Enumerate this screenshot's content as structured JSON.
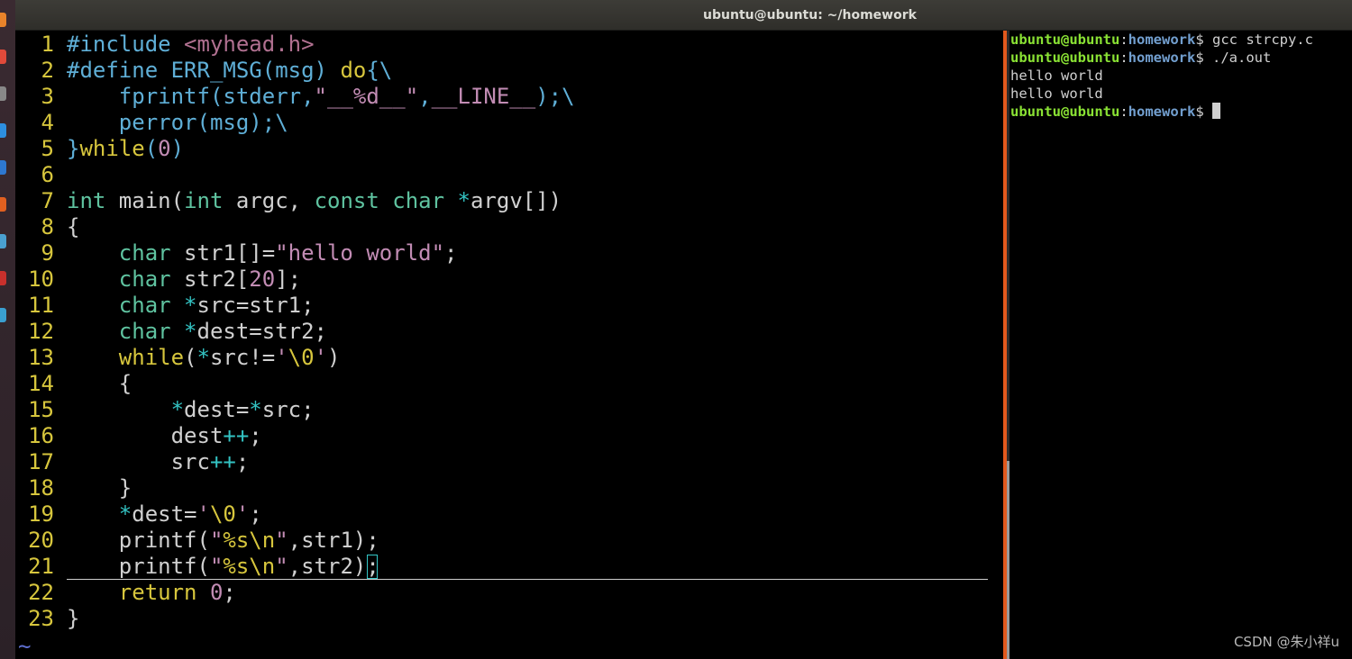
{
  "window": {
    "title": "ubuntu@ubuntu: ~/homework"
  },
  "launcher": {
    "icons": [
      "app-icon-1",
      "app-icon-2",
      "app-icon-3",
      "app-icon-4",
      "app-icon-5",
      "app-icon-6",
      "app-icon-7",
      "terminal-icon",
      "settings-icon"
    ],
    "colors": [
      "#e8832a",
      "#e04a3a",
      "#888888",
      "#2d8fe0",
      "#2e78d0",
      "#e06020",
      "#4aa0d0",
      "#c8302c",
      "#3a9fd0"
    ]
  },
  "vim": {
    "lines": [
      {
        "n": "1",
        "tokens": [
          [
            "pp",
            "#include "
          ],
          [
            "inc",
            "<myhead.h>"
          ]
        ]
      },
      {
        "n": "2",
        "tokens": [
          [
            "pp",
            "#define ERR_MSG(msg) "
          ],
          [
            "kw",
            "do"
          ],
          [
            "pp",
            "{\\"
          ]
        ]
      },
      {
        "n": "3",
        "tokens": [
          [
            "pp",
            "    fprintf(stderr,"
          ],
          [
            "str",
            "\"__%d__\""
          ],
          [
            "pp",
            ","
          ],
          [
            "str",
            "__LINE__"
          ],
          [
            "pp",
            ");\\"
          ]
        ]
      },
      {
        "n": "4",
        "tokens": [
          [
            "pp",
            "    perror(msg);\\"
          ]
        ]
      },
      {
        "n": "5",
        "tokens": [
          [
            "pp",
            "}"
          ],
          [
            "kw",
            "while"
          ],
          [
            "pp",
            "("
          ],
          [
            "num",
            "0"
          ],
          [
            "pp",
            ")"
          ]
        ]
      },
      {
        "n": "6",
        "tokens": []
      },
      {
        "n": "7",
        "tokens": [
          [
            "ty",
            "int"
          ],
          [
            "br",
            " main("
          ],
          [
            "ty",
            "int"
          ],
          [
            "br",
            " argc, "
          ],
          [
            "ty",
            "const char"
          ],
          [
            "br",
            " "
          ],
          [
            "op",
            "*"
          ],
          [
            "br",
            "argv[])"
          ]
        ]
      },
      {
        "n": "8",
        "tokens": [
          [
            "br",
            "{"
          ]
        ]
      },
      {
        "n": "9",
        "tokens": [
          [
            "br",
            "    "
          ],
          [
            "ty",
            "char"
          ],
          [
            "br",
            " str1[]="
          ],
          [
            "str",
            "\"hello world\""
          ],
          [
            "br",
            ";"
          ]
        ]
      },
      {
        "n": "10",
        "tokens": [
          [
            "br",
            "    "
          ],
          [
            "ty",
            "char"
          ],
          [
            "br",
            " str2["
          ],
          [
            "num",
            "20"
          ],
          [
            "br",
            "];"
          ]
        ]
      },
      {
        "n": "11",
        "tokens": [
          [
            "br",
            "    "
          ],
          [
            "ty",
            "char"
          ],
          [
            "br",
            " "
          ],
          [
            "op",
            "*"
          ],
          [
            "br",
            "src=str1;"
          ]
        ]
      },
      {
        "n": "12",
        "tokens": [
          [
            "br",
            "    "
          ],
          [
            "ty",
            "char"
          ],
          [
            "br",
            " "
          ],
          [
            "op",
            "*"
          ],
          [
            "br",
            "dest=str2;"
          ]
        ]
      },
      {
        "n": "13",
        "tokens": [
          [
            "br",
            "    "
          ],
          [
            "kw",
            "while"
          ],
          [
            "br",
            "("
          ],
          [
            "op",
            "*"
          ],
          [
            "br",
            "src!="
          ],
          [
            "str",
            "'"
          ],
          [
            "sp",
            "\\0"
          ],
          [
            "str",
            "'"
          ],
          [
            "br",
            ")"
          ]
        ]
      },
      {
        "n": "14",
        "tokens": [
          [
            "br",
            "    {"
          ]
        ]
      },
      {
        "n": "15",
        "tokens": [
          [
            "br",
            "        "
          ],
          [
            "op",
            "*"
          ],
          [
            "br",
            "dest="
          ],
          [
            "op",
            "*"
          ],
          [
            "br",
            "src;"
          ]
        ]
      },
      {
        "n": "16",
        "tokens": [
          [
            "br",
            "        dest"
          ],
          [
            "op",
            "++"
          ],
          [
            "br",
            ";"
          ]
        ]
      },
      {
        "n": "17",
        "tokens": [
          [
            "br",
            "        src"
          ],
          [
            "op",
            "++"
          ],
          [
            "br",
            ";"
          ]
        ]
      },
      {
        "n": "18",
        "tokens": [
          [
            "br",
            "    }"
          ]
        ]
      },
      {
        "n": "19",
        "tokens": [
          [
            "br",
            "    "
          ],
          [
            "op",
            "*"
          ],
          [
            "br",
            "dest="
          ],
          [
            "str",
            "'"
          ],
          [
            "sp",
            "\\0"
          ],
          [
            "str",
            "'"
          ],
          [
            "br",
            ";"
          ]
        ]
      },
      {
        "n": "20",
        "tokens": [
          [
            "br",
            "    printf("
          ],
          [
            "str",
            "\""
          ],
          [
            "sp",
            "%s\\n"
          ],
          [
            "str",
            "\""
          ],
          [
            "br",
            ",str1);"
          ]
        ]
      },
      {
        "n": "21",
        "tokens": [
          [
            "br",
            "    printf("
          ],
          [
            "str",
            "\""
          ],
          [
            "sp",
            "%s\\n"
          ],
          [
            "str",
            "\""
          ],
          [
            "br",
            ",str2);"
          ]
        ]
      },
      {
        "n": "22",
        "tokens": [
          [
            "br",
            "    "
          ],
          [
            "kw",
            "return"
          ],
          [
            "br",
            " "
          ],
          [
            "num",
            "0"
          ],
          [
            "br",
            ";"
          ]
        ]
      },
      {
        "n": "23",
        "tokens": [
          [
            "br",
            "}"
          ]
        ]
      }
    ],
    "tilde": "~",
    "cursor_line": "21"
  },
  "terminal": {
    "lines": [
      {
        "user": "ubuntu@ubuntu",
        "colon": ":",
        "path": "homework",
        "cmd": "$ gcc strcpy.c"
      },
      {
        "user": "ubuntu@ubuntu",
        "colon": ":",
        "path": "homework",
        "cmd": "$ ./a.out"
      },
      {
        "text": "hello world"
      },
      {
        "text": "hello world"
      },
      {
        "user": "ubuntu@ubuntu",
        "colon": ":",
        "path": "homework",
        "cmd": "$ ",
        "cursor": true
      }
    ]
  },
  "watermark": "CSDN @朱小祥u"
}
